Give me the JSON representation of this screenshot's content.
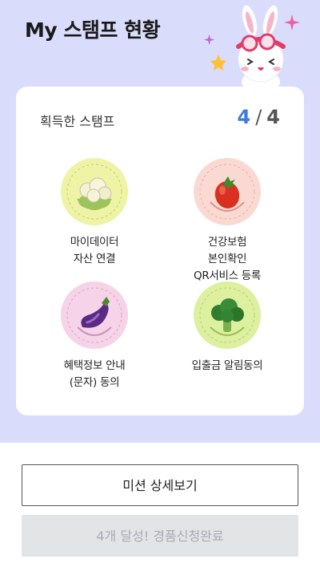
{
  "header": {
    "title": "My 스탬프 현황"
  },
  "card": {
    "label": "획득한 스탬프",
    "count_current": "4",
    "count_separator": "/",
    "count_total": "4"
  },
  "stamps": [
    {
      "label": "마이데이터\n자산 연결",
      "icon": "cauliflower-icon",
      "color": "#eef3a6"
    },
    {
      "label": "건강보험\n본인확인\nQR서비스 등록",
      "icon": "tomato-icon",
      "color": "#fbd9d3"
    },
    {
      "label": "혜택정보 안내\n(문자) 동의",
      "icon": "eggplant-icon",
      "color": "#f6d3e8"
    },
    {
      "label": "입출금 알림동의",
      "icon": "broccoli-icon",
      "color": "#dcf0a0"
    }
  ],
  "buttons": {
    "detail": "미션 상세보기",
    "complete": "4개 달성! 경품신청완료"
  },
  "colors": {
    "hero_bg": "#d9dcfb",
    "accent_blue": "#3d7be0",
    "disabled_bg": "#e2e4e6"
  }
}
